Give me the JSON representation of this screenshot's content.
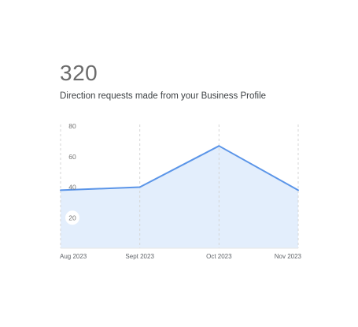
{
  "summary": {
    "value": "320",
    "description": "Direction requests made from your Business Profile"
  },
  "colors": {
    "line": "#5b95e8",
    "area": "#e3eefc",
    "grid": "#d6d6d6"
  },
  "chart_data": {
    "type": "area",
    "title": "",
    "xlabel": "",
    "ylabel": "",
    "categories": [
      "Aug 2023",
      "Sept 2023",
      "Oct 2023",
      "Nov 2023"
    ],
    "series": [
      {
        "values": [
          38,
          40,
          67,
          38
        ]
      }
    ],
    "yticks": [
      20,
      40,
      60,
      80
    ],
    "ylim": [
      0,
      80
    ],
    "grid": "vertical dashed",
    "legend": "none"
  }
}
